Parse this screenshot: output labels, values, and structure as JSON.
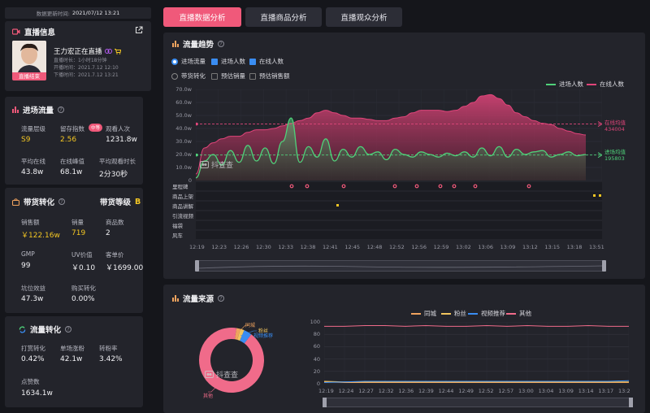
{
  "header": {
    "update_time_label": "数据更新时间:",
    "update_time": "2021/07/12 13:21"
  },
  "live_info": {
    "title": "直播信息",
    "streamer": "王力宏正在直播",
    "duration": "直播时长：1小时18分钟",
    "start_time": "开播时间：2021.7.12 12:10",
    "end_time": "下播时间：2021.7.12 13:21",
    "status_badge": "直播结束"
  },
  "traffic": {
    "title": "进场流量",
    "metrics": [
      {
        "label": "流量层级",
        "value": "S9"
      },
      {
        "label": "留存指数",
        "value": "2.56",
        "badge": "中等"
      },
      {
        "label": "观看人次",
        "value": "1231.8w"
      },
      {
        "label": "平均在线",
        "value": "43.8w"
      },
      {
        "label": "在线峰值",
        "value": "68.1w"
      },
      {
        "label": "平均观看时长",
        "value": "2分30秒"
      }
    ]
  },
  "sales": {
    "title": "带货转化",
    "level_label": "带货等级",
    "level": "B",
    "metrics": [
      {
        "label": "销售额",
        "value": "￥122.16w"
      },
      {
        "label": "销量",
        "value": "719"
      },
      {
        "label": "商品数",
        "value": "2"
      },
      {
        "label": "GMP",
        "value": "99"
      },
      {
        "label": "UV价值",
        "value": "￥0.10"
      },
      {
        "label": "客单价",
        "value": "￥1699.00"
      },
      {
        "label": "坑位效益",
        "value": "47.3w"
      },
      {
        "label": "购买转化",
        "value": "0.00%"
      }
    ]
  },
  "conversion": {
    "title": "流量转化",
    "metrics": [
      {
        "label": "打赏转化",
        "value": "0.42%"
      },
      {
        "label": "单场涨粉",
        "value": "42.1w"
      },
      {
        "label": "转粉率",
        "value": "3.42%"
      },
      {
        "label": "点赞数",
        "value": "1634.1w"
      }
    ]
  },
  "tabs": [
    "直播数据分析",
    "直播商品分析",
    "直播观众分析"
  ],
  "trend": {
    "title": "流量趋势",
    "options_row1": [
      {
        "label": "进场流量",
        "type": "radio",
        "on": true
      },
      {
        "label": "进场人数",
        "type": "check",
        "on": true
      },
      {
        "label": "在线人数",
        "type": "check",
        "on": true
      }
    ],
    "options_row2": [
      {
        "label": "带货转化",
        "type": "radio",
        "on": false
      },
      {
        "label": "预估销量",
        "type": "check",
        "on": false
      },
      {
        "label": "预估销售额",
        "type": "check",
        "on": false
      }
    ],
    "legend": [
      "进场人数",
      "在线人数"
    ],
    "mark_online_label": "在线均值",
    "mark_online_value": "434004",
    "mark_enter_label": "进场均值",
    "mark_enter_value": "195803",
    "event_rows": [
      "里程碑",
      "商品上架",
      "商品讲解",
      "引流视频",
      "福袋",
      "风车"
    ],
    "watermark": "抖查查"
  },
  "source": {
    "title": "流量来源",
    "donut_labels": [
      "同城",
      "粉丝",
      "视频推荐",
      "其他"
    ],
    "legend": [
      "同城",
      "粉丝",
      "视频推荐",
      "其他"
    ],
    "watermark": "抖查查"
  },
  "chart_data": [
    {
      "type": "area",
      "title": "流量趋势",
      "x": [
        "12:19",
        "12:23",
        "12:26",
        "12:30",
        "12:33",
        "12:38",
        "12:41",
        "12:45",
        "12:48",
        "12:52",
        "12:56",
        "12:59",
        "13:02",
        "13:06",
        "13:09",
        "13:12",
        "13:15",
        "13:18",
        "13:51"
      ],
      "y_ticks": [
        "0",
        "10.0w",
        "20.0w",
        "30.0w",
        "40.0w",
        "50.0w",
        "60.0w",
        "70.0w"
      ],
      "ylim": [
        0,
        70
      ],
      "series": [
        {
          "name": "在线人数",
          "color": "#e0457a",
          "values": [
            5,
            25,
            29,
            32,
            34,
            34,
            37,
            39,
            39,
            40,
            42,
            44,
            46,
            48,
            52,
            54,
            52,
            50,
            48,
            48,
            47,
            46,
            46,
            48,
            49,
            52,
            54,
            54,
            54,
            53,
            54,
            57,
            60,
            65,
            66,
            63,
            58,
            52,
            49,
            46,
            44,
            43,
            40,
            38,
            36,
            35
          ]
        },
        {
          "name": "进场人数",
          "color": "#4fd17a",
          "values": [
            2,
            15,
            20,
            12,
            23,
            14,
            27,
            15,
            25,
            13,
            30,
            48,
            14,
            26,
            18,
            32,
            15,
            24,
            18,
            26,
            20,
            22,
            16,
            24,
            20,
            18,
            22,
            20,
            18,
            21,
            19,
            22,
            18,
            25,
            19,
            26,
            18,
            24,
            20,
            22,
            23,
            18,
            20,
            22,
            19,
            20
          ]
        }
      ],
      "markers": [
        {
          "name": "在线均值",
          "value": 43.4
        },
        {
          "name": "进场均值",
          "value": 19.58
        }
      ]
    },
    {
      "type": "pie",
      "title": "流量来源",
      "categories": [
        "同城",
        "粉丝",
        "视频推荐",
        "其他"
      ],
      "values": [
        2,
        2,
        4,
        92
      ],
      "colors": [
        "#f0a35e",
        "#f0c45e",
        "#3a8df2",
        "#f06b8a"
      ]
    },
    {
      "type": "line",
      "x": [
        "12:19",
        "12:24",
        "12:27",
        "12:32",
        "12:36",
        "12:39",
        "12:44",
        "12:49",
        "12:52",
        "12:57",
        "13:00",
        "13:04",
        "13:09",
        "13:14",
        "13:17",
        "13:2"
      ],
      "y_ticks": [
        "0",
        "20",
        "40",
        "60",
        "80",
        "100"
      ],
      "ylim": [
        0,
        100
      ],
      "series": [
        {
          "name": "同城",
          "color": "#f0a35e",
          "values": [
            3,
            2,
            2,
            2,
            2,
            2,
            2,
            2,
            2,
            2,
            2,
            2,
            2,
            2,
            2,
            2
          ]
        },
        {
          "name": "粉丝",
          "color": "#f0c45e",
          "values": [
            4,
            3,
            3,
            3,
            3,
            3,
            3,
            3,
            3,
            3,
            3,
            3,
            3,
            3,
            3,
            3
          ]
        },
        {
          "name": "视频推荐",
          "color": "#3a8df2",
          "values": [
            2,
            3,
            4,
            4,
            4,
            4,
            4,
            4,
            4,
            4,
            4,
            4,
            4,
            4,
            4,
            5
          ]
        },
        {
          "name": "其他",
          "color": "#f06b8a",
          "values": [
            93,
            93,
            94,
            94,
            93,
            94,
            93,
            93,
            94,
            93,
            94,
            93,
            93,
            94,
            93,
            93
          ]
        }
      ]
    }
  ]
}
